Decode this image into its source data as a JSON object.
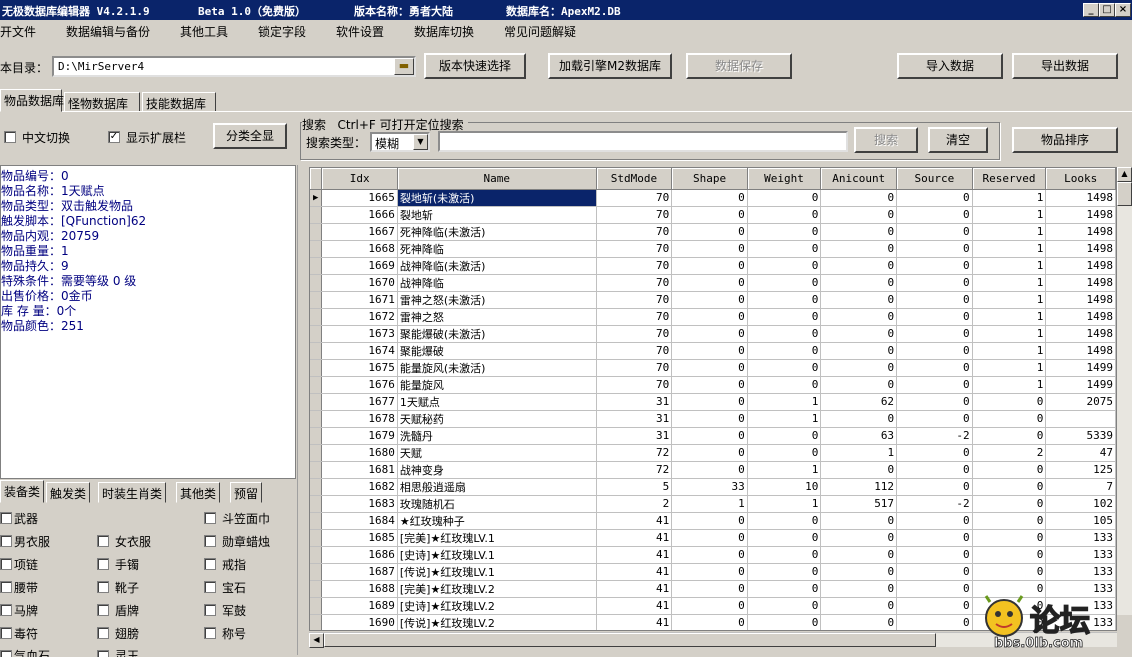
{
  "titlebar": {
    "app": "无极数据库编辑器 V4.2.1.9",
    "edition": "Beta 1.0（免费版）",
    "version_label": "版本名称：勇者大陆",
    "db_label": "数据库名：ApexM2.DB"
  },
  "menu": [
    "开文件",
    "数据编辑与备份",
    "其他工具",
    "锁定字段",
    "软件设置",
    "数据库切换",
    "常见问题解疑"
  ],
  "toolbar": {
    "dir_label": "本目录：",
    "dir_value": "D:\\MirServer4",
    "quick_select": "版本快速选择",
    "load_engine": "加载引擎M2数据库",
    "save_data": "数据保存",
    "import": "导入数据",
    "export": "导出数据"
  },
  "tabs": [
    "物品数据库",
    "怪物数据库",
    "技能数据库"
  ],
  "options": {
    "chinese_switch": "中文切换",
    "show_ext": "显示扩展栏",
    "show_ext_checked": true,
    "category_all": "分类全显"
  },
  "search": {
    "group_title": "搜索",
    "hint": "Ctrl+F 可打开定位搜索",
    "type_label": "搜索类型：",
    "type_value": "模糊",
    "search_btn": "搜索",
    "clear_btn": "清空",
    "sort_btn": "物品排序"
  },
  "info": [
    "物品编号：0",
    "物品名称：1天赋点",
    "物品类型：双击触发物品",
    "触发脚本：[QFunction]62",
    "物品内观：20759",
    "物品重量：1",
    "物品持久：9",
    "特殊条件：需要等级 0 级",
    "出售价格：0金币",
    "库 存 量：0个",
    "物品颜色：251"
  ],
  "category_tabs": [
    "装备类",
    "触发类",
    "时装生肖类",
    "其他类",
    "预留"
  ],
  "categories": [
    [
      "武器",
      "",
      "斗笠面巾"
    ],
    [
      "男衣服",
      "女衣服",
      "勋章蜡烛"
    ],
    [
      "项链",
      "手镯",
      "戒指"
    ],
    [
      "腰带",
      "靴子",
      "宝石"
    ],
    [
      "马牌",
      "盾牌",
      "军鼓"
    ],
    [
      "毒符",
      "翅膀",
      "称号"
    ],
    [
      "气血石",
      "灵玉",
      ""
    ]
  ],
  "columns": [
    "Idx",
    "Name",
    "StdMode",
    "Shape",
    "Weight",
    "Anicount",
    "Source",
    "Reserved",
    "Looks"
  ],
  "rows": [
    [
      "1665",
      "裂地斩(未激活)",
      "70",
      "0",
      "0",
      "0",
      "0",
      "1",
      "1498"
    ],
    [
      "1666",
      "裂地斩",
      "70",
      "0",
      "0",
      "0",
      "0",
      "1",
      "1498"
    ],
    [
      "1667",
      "死神降临(未激活)",
      "70",
      "0",
      "0",
      "0",
      "0",
      "1",
      "1498"
    ],
    [
      "1668",
      "死神降临",
      "70",
      "0",
      "0",
      "0",
      "0",
      "1",
      "1498"
    ],
    [
      "1669",
      "战神降临(未激活)",
      "70",
      "0",
      "0",
      "0",
      "0",
      "1",
      "1498"
    ],
    [
      "1670",
      "战神降临",
      "70",
      "0",
      "0",
      "0",
      "0",
      "1",
      "1498"
    ],
    [
      "1671",
      "雷神之怒(未激活)",
      "70",
      "0",
      "0",
      "0",
      "0",
      "1",
      "1498"
    ],
    [
      "1672",
      "雷神之怒",
      "70",
      "0",
      "0",
      "0",
      "0",
      "1",
      "1498"
    ],
    [
      "1673",
      "聚能爆破(未激活)",
      "70",
      "0",
      "0",
      "0",
      "0",
      "1",
      "1498"
    ],
    [
      "1674",
      "聚能爆破",
      "70",
      "0",
      "0",
      "0",
      "0",
      "1",
      "1498"
    ],
    [
      "1675",
      "能量旋风(未激活)",
      "70",
      "0",
      "0",
      "0",
      "0",
      "1",
      "1499"
    ],
    [
      "1676",
      "能量旋风",
      "70",
      "0",
      "0",
      "0",
      "0",
      "1",
      "1499"
    ],
    [
      "1677",
      "1天赋点",
      "31",
      "0",
      "1",
      "62",
      "0",
      "0",
      "2075"
    ],
    [
      "1678",
      "天赋秘药",
      "31",
      "0",
      "1",
      "0",
      "0",
      "0",
      ""
    ],
    [
      "1679",
      "洗髓丹",
      "31",
      "0",
      "0",
      "63",
      "-2",
      "0",
      "5339"
    ],
    [
      "1680",
      "天赋",
      "72",
      "0",
      "0",
      "1",
      "0",
      "2",
      "47"
    ],
    [
      "1681",
      "战神变身",
      "72",
      "0",
      "1",
      "0",
      "0",
      "0",
      "125"
    ],
    [
      "1682",
      "相思般逍遥扇",
      "5",
      "33",
      "10",
      "112",
      "0",
      "0",
      "7"
    ],
    [
      "1683",
      "玫瑰随机石",
      "2",
      "1",
      "1",
      "517",
      "-2",
      "0",
      "102"
    ],
    [
      "1684",
      "★红玫瑰种子",
      "41",
      "0",
      "0",
      "0",
      "0",
      "0",
      "105"
    ],
    [
      "1685",
      "[完美]★红玫瑰LV.1",
      "41",
      "0",
      "0",
      "0",
      "0",
      "0",
      "133"
    ],
    [
      "1686",
      "[史诗]★红玫瑰LV.1",
      "41",
      "0",
      "0",
      "0",
      "0",
      "0",
      "133"
    ],
    [
      "1687",
      "[传说]★红玫瑰LV.1",
      "41",
      "0",
      "0",
      "0",
      "0",
      "0",
      "133"
    ],
    [
      "1688",
      "[完美]★红玫瑰LV.2",
      "41",
      "0",
      "0",
      "0",
      "0",
      "0",
      "133"
    ],
    [
      "1689",
      "[史诗]★红玫瑰LV.2",
      "41",
      "0",
      "0",
      "0",
      "0",
      "0",
      "133"
    ],
    [
      "1690",
      "[传说]★红玫瑰LV.2",
      "41",
      "0",
      "0",
      "0",
      "0",
      "0",
      "133"
    ],
    [
      "1691",
      "[完美]★红玫瑰LV.3",
      "41",
      "0",
      "0",
      "0",
      "0",
      "0",
      "133"
    ]
  ],
  "watermark": {
    "brand": "论坛",
    "url": "bbs.0lb.com"
  }
}
